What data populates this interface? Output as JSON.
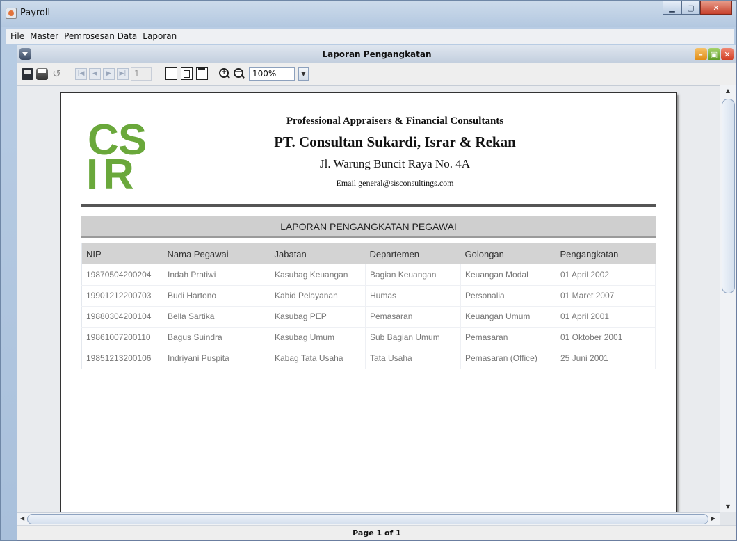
{
  "window": {
    "title": "Payroll",
    "controls": {
      "minimize_icon": "minimize-icon",
      "maximize_icon": "maximize-icon",
      "close_icon": "close-icon"
    }
  },
  "menubar": {
    "items": [
      "File",
      "Master",
      "Pemrosesan Data",
      "Laporan"
    ]
  },
  "report_frame": {
    "title": "Laporan Pengangkatan"
  },
  "toolbar": {
    "page_number": "1",
    "zoom_value": "100%",
    "icons": [
      "save-icon",
      "print-icon",
      "reload-icon",
      "first-page-icon",
      "previous-page-icon",
      "next-page-icon",
      "last-page-icon",
      "actual-size-icon",
      "fit-width-icon",
      "fit-page-icon",
      "zoom-in-icon",
      "zoom-out-icon"
    ]
  },
  "report": {
    "logo_text": "CSIR",
    "logo_color": "#6aa83b",
    "subtitle": "Professional Appraisers & Financial Consultants",
    "company": "PT. Consultan Sukardi, Israr & Rekan",
    "address": "Jl. Warung Buncit Raya No. 4A",
    "email": "Email general@sisconsultings.com",
    "title": "LAPORAN PENGANGKATAN PEGAWAI",
    "columns": [
      "NIP",
      "Nama Pegawai",
      "Jabatan",
      "Departemen",
      "Golongan",
      "Pengangkatan"
    ],
    "rows": [
      [
        "19870504200204",
        "Indah Pratiwi",
        "Kasubag Keuangan",
        "Bagian Keuangan",
        "Keuangan Modal",
        "01 April 2002"
      ],
      [
        "19901212200703",
        "Budi Hartono",
        "Kabid Pelayanan",
        "Humas",
        "Personalia",
        "01 Maret 2007"
      ],
      [
        "19880304200104",
        "Bella Sartika",
        "Kasubag PEP",
        "Pemasaran",
        "Keuangan Umum",
        "01 April 2001"
      ],
      [
        "19861007200110",
        "Bagus Suindra",
        "Kasubag Umum",
        "Sub Bagian Umum",
        "Pemasaran",
        "01 Oktober 2001"
      ],
      [
        "19851213200106",
        "Indriyani Puspita",
        "Kabag Tata Usaha",
        "Tata Usaha",
        "Pemasaran (Office)",
        "25 Juni 2001"
      ]
    ]
  },
  "status": {
    "page_text": "Page 1 of 1"
  }
}
